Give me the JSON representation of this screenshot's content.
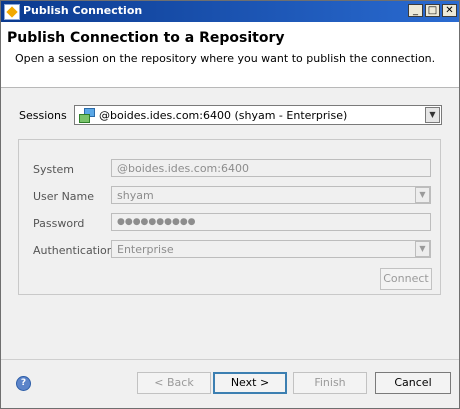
{
  "window": {
    "title": "Publish Connection",
    "controls": {
      "minimize": "_",
      "maximize": "□",
      "close": "✕"
    }
  },
  "banner": {
    "heading": "Publish Connection to a Repository",
    "description": "Open a session on the repository where you want to publish the connection."
  },
  "sessions": {
    "label": "Sessions",
    "selected": "@boides.ides.com:6400 (shyam - Enterprise)",
    "icon": "repository-icon"
  },
  "connection": {
    "system": {
      "label": "System",
      "value": "@boides.ides.com:6400"
    },
    "username": {
      "label": "User Name",
      "value": "shyam"
    },
    "password": {
      "label": "Password",
      "value": "●●●●●●●●●●"
    },
    "authentication": {
      "label": "Authentication",
      "value": "Enterprise"
    },
    "connect_label": "Connect"
  },
  "footer": {
    "back_label": "< Back",
    "next_label": "Next >",
    "finish_label": "Finish",
    "cancel_label": "Cancel",
    "help_icon": "help-icon"
  }
}
